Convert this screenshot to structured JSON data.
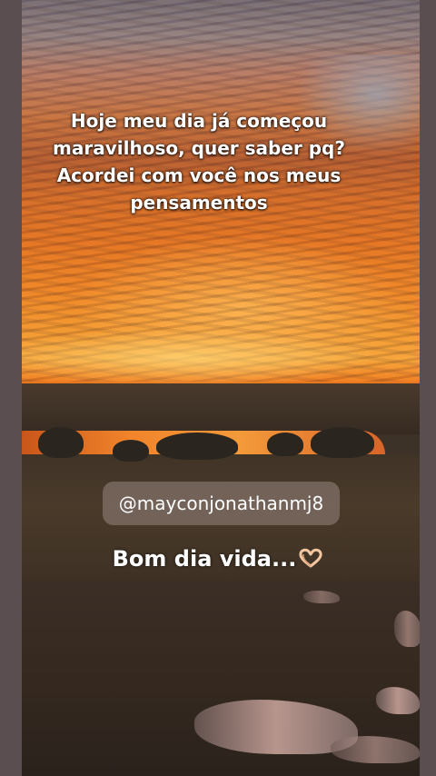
{
  "story": {
    "caption": "Hoje meu dia já começou\nmaravilhoso, quer saber pq?\nAcordei com você nos meus\npensamentos",
    "mention": "@mayconjonathanmj8",
    "greeting": "Bom dia vida...",
    "greeting_emoji_icon": "heart-hands-icon"
  }
}
